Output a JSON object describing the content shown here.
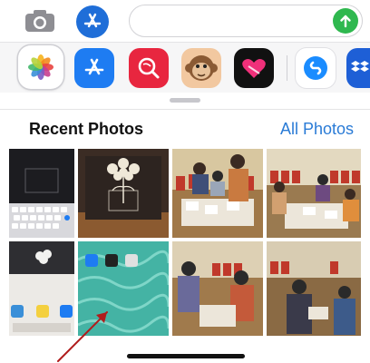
{
  "compose": {
    "placeholder": ""
  },
  "drawer": {
    "apps": [
      "photos",
      "app-store",
      "search-images",
      "animoji",
      "heart-stickers",
      "shazam",
      "dropbox"
    ]
  },
  "photos_sheet": {
    "title": "Recent Photos",
    "all_photos_label": "All Photos"
  },
  "colors": {
    "accent": "#2a7bd6",
    "send": "#2fb84f",
    "app_store": "#1e7cf2"
  }
}
